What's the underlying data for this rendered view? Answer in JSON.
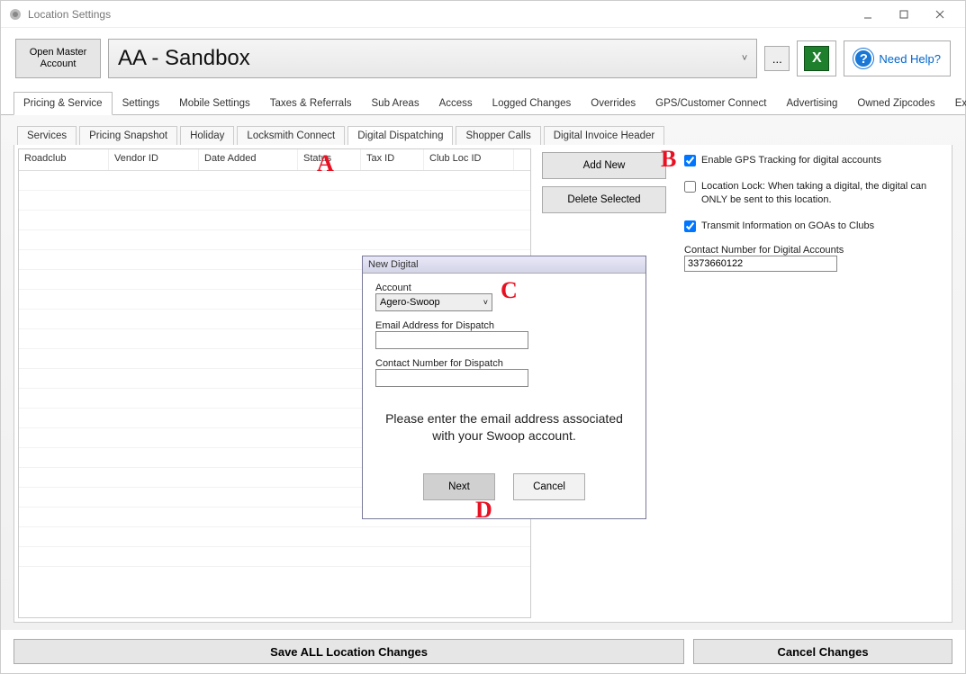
{
  "window": {
    "title": "Location Settings"
  },
  "toolbar": {
    "open_master": "Open Master Account",
    "account_name": "AA - Sandbox",
    "ellipsis": "...",
    "help": "Need Help?"
  },
  "main_tabs": [
    "Pricing & Service",
    "Settings",
    "Mobile Settings",
    "Taxes & Referrals",
    "Sub Areas",
    "Access",
    "Logged Changes",
    "Overrides",
    "GPS/Customer Connect",
    "Advertising",
    "Owned Zipcodes",
    "External Integrations"
  ],
  "main_tab_active": 0,
  "sub_tabs": [
    "Services",
    "Pricing Snapshot",
    "Holiday",
    "Locksmith Connect",
    "Digital Dispatching",
    "Shopper Calls",
    "Digital Invoice Header"
  ],
  "sub_tab_active": 4,
  "grid_columns": [
    "Roadclub",
    "Vendor ID",
    "Date Added",
    "Status",
    "Tax ID",
    "Club Loc ID"
  ],
  "mid_buttons": {
    "add": "Add New",
    "delete": "Delete Selected"
  },
  "right": {
    "enable_gps": "Enable GPS Tracking for digital accounts",
    "enable_gps_checked": true,
    "location_lock": "Location Lock:  When taking a digital, the digital can ONLY be sent to this location.",
    "location_lock_checked": false,
    "transmit": "Transmit Information on GOAs to Clubs",
    "transmit_checked": true,
    "contact_label": "Contact Number for Digital Accounts",
    "contact_value": "3373660122"
  },
  "dialog": {
    "title": "New Digital",
    "account_label": "Account",
    "account_value": "Agero-Swoop",
    "email_label": "Email Address for Dispatch",
    "contact_label": "Contact Number for Dispatch",
    "message": "Please enter the email address associated with your Swoop account.",
    "next": "Next",
    "cancel": "Cancel"
  },
  "bottom": {
    "save": "Save ALL Location Changes",
    "cancel": "Cancel Changes"
  },
  "annotations": {
    "a": "A",
    "b": "B",
    "c": "C",
    "d": "D"
  }
}
